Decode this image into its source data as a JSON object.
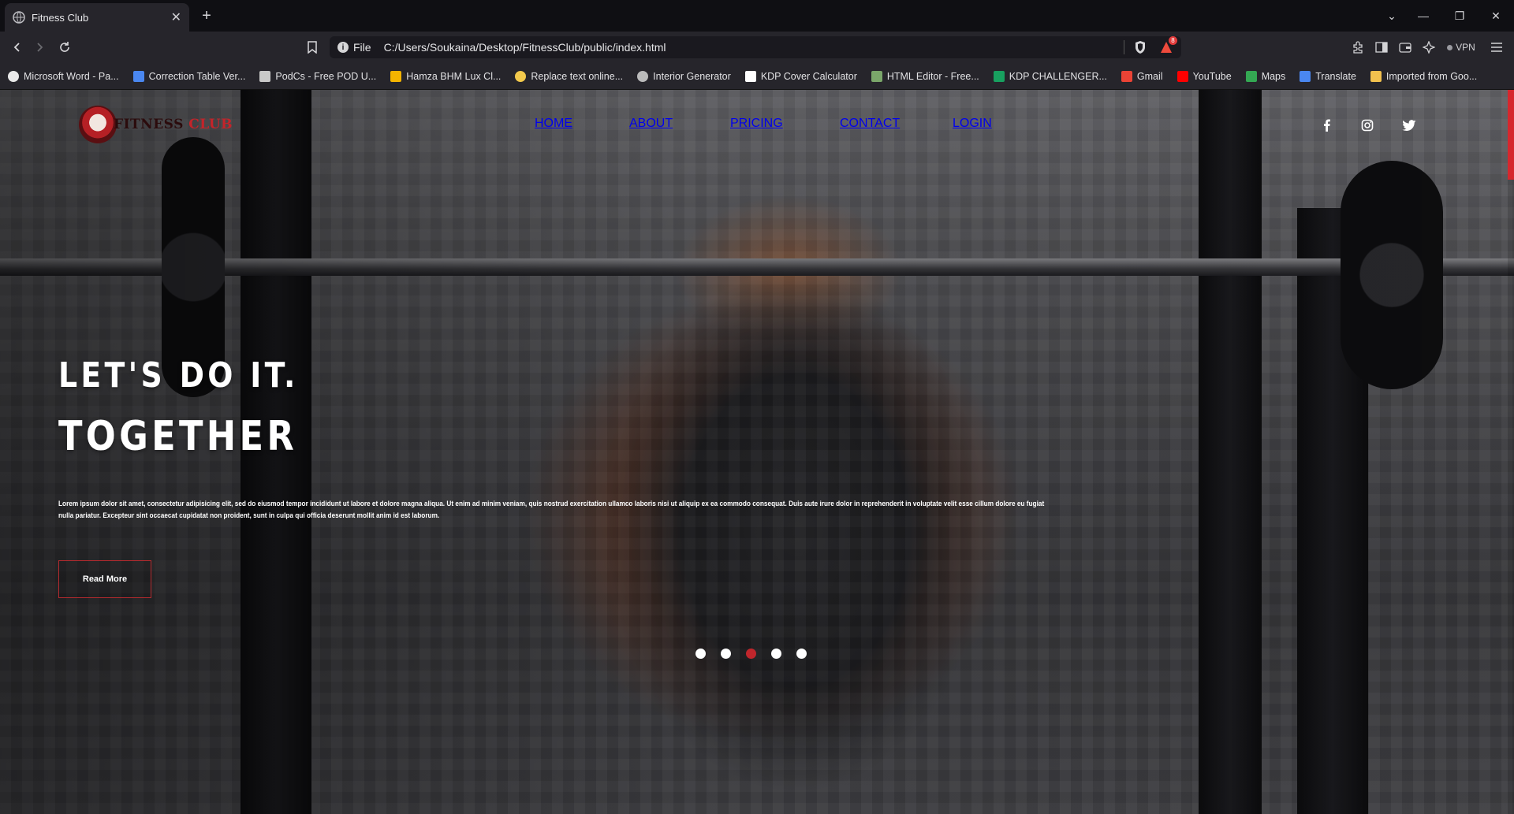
{
  "browser": {
    "tab": {
      "title": "Fitness Club"
    },
    "address": {
      "scheme": "File",
      "url": "C:/Users/Soukaina/Desktop/FitnessClub/public/index.html"
    },
    "shields_badge": "8",
    "vpn_label": "VPN",
    "bookmarks": [
      {
        "label": "Microsoft Word - Pa...",
        "icon": "wordpress-icon",
        "color": "#e9e9e9"
      },
      {
        "label": "Correction Table Ver...",
        "icon": "docs-icon",
        "color": "#4a87f0"
      },
      {
        "label": "PodCs - Free POD U...",
        "icon": "pod-icon",
        "color": "#c9c9c9"
      },
      {
        "label": "Hamza BHM Lux Cl...",
        "icon": "drive-icon",
        "color": "#f4b400"
      },
      {
        "label": "Replace text online...",
        "icon": "replace-icon",
        "color": "#f2c94c"
      },
      {
        "label": "Interior Generator",
        "icon": "globe-icon",
        "color": "#bbbbbb"
      },
      {
        "label": "KDP Cover Calculator",
        "icon": "amazon-icon",
        "color": "#ffffff"
      },
      {
        "label": "HTML Editor - Free...",
        "icon": "html-icon",
        "color": "#7aa66a"
      },
      {
        "label": "KDP CHALLENGER...",
        "icon": "sheets-icon",
        "color": "#18a05f"
      },
      {
        "label": "Gmail",
        "icon": "gmail-icon",
        "color": "#ea4335"
      },
      {
        "label": "YouTube",
        "icon": "youtube-icon",
        "color": "#ff0000"
      },
      {
        "label": "Maps",
        "icon": "maps-icon",
        "color": "#34a853"
      },
      {
        "label": "Translate",
        "icon": "translate-icon",
        "color": "#4a87f0"
      },
      {
        "label": "Imported from Goo...",
        "icon": "folder-icon",
        "color": "#f2c14e"
      }
    ]
  },
  "site": {
    "logo": {
      "word1": "FITNESS",
      "word2": "CLUB"
    },
    "nav": [
      "HOME",
      "ABOUT",
      "PRICING",
      "CONTACT",
      "LOGIN"
    ],
    "social": [
      "facebook-icon",
      "instagram-icon",
      "twitter-icon"
    ],
    "hero": {
      "line1": "LET'S DO IT.",
      "line2": "TOGETHER",
      "paragraph": "Lorem ipsum dolor sit amet, consectetur adipisicing elit, sed do eiusmod tempor incididunt ut labore et dolore magna aliqua. Ut enim ad minim veniam, quis nostrud exercitation ullamco laboris nisi ut aliquip ex ea commodo consequat. Duis aute irure dolor in reprehenderit in voluptate velit esse cillum dolore eu fugiat nulla pariatur. Excepteur sint occaecat cupidatat non proident, sunt in culpa qui officia deserunt mollit anim id est laborum.",
      "button": "Read More"
    },
    "slider": {
      "count": 5,
      "active_index": 2
    },
    "colors": {
      "accent": "#c0262c"
    }
  }
}
